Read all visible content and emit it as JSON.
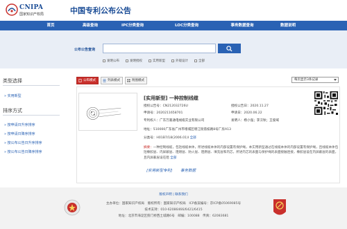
{
  "header": {
    "logo_en": "CNIPA",
    "logo_cn": "国家知识产权局",
    "title": "中国专利公布公告"
  },
  "nav": {
    "items": [
      {
        "label": "首页"
      },
      {
        "label": "高级查询"
      },
      {
        "label": "IPC分类查询"
      },
      {
        "label": "LOC分类查询"
      },
      {
        "label": "事务数据查询"
      },
      {
        "label": "数据说明"
      }
    ]
  },
  "search": {
    "label": "公布公告查询",
    "value": "",
    "placeholder": "",
    "filters": [
      {
        "label": "发明公布"
      },
      {
        "label": "发明授权"
      },
      {
        "label": "实用新型"
      },
      {
        "label": "外观设计"
      },
      {
        "label": "全部"
      }
    ]
  },
  "sidebar": {
    "type_heading": "类型选择",
    "type_items": [
      {
        "label": "实用新型"
      }
    ],
    "sort_heading": "排序方式",
    "sort_items": [
      {
        "label": "按申请日升序排序"
      },
      {
        "label": "按申请日降序排序"
      },
      {
        "label": "按公布公告日升序排序"
      },
      {
        "label": "按公布公告日降序排序"
      }
    ]
  },
  "toolbar": {
    "tabs": [
      {
        "label": "公布模式",
        "active": true
      },
      {
        "label": "列表模式",
        "active": false
      },
      {
        "label": "附图模式",
        "active": false
      }
    ],
    "per_page": "每页显示3条记录"
  },
  "result": {
    "title": "[实用新型] 一种控制线缆",
    "pub_no_label": "授权公告号：",
    "pub_no": "CN212032726U",
    "pub_date_label": "授权公告日：",
    "pub_date": "2020.11.27",
    "app_no_label": "申请号：",
    "app_no": "2020211658701",
    "app_date_label": "申请日：",
    "app_date": "2020.06.22",
    "patentee_label": "专利权人：",
    "patentee": "广东万嘉通电线缆实业有限公司",
    "inventor_label": "发明人：",
    "inventor": "杨小强；李汉秋；王俊域",
    "address_label": "地址：",
    "address": "510000广东省广州市增城区增江街荔枝路8号厂房A13",
    "ipc_label": "分类号：",
    "ipc": "H01B7/18(2006.01)I",
    "ipc_all": "全部",
    "abstract_label": "摘要：",
    "abstract": "一种控制线缆，包括线缆本体，所述线缆本体的内部设置有保护绳，本实用新型通过在线缆本体的内部设置有保护绳，且线缆本体包括橡胶层、内屏蔽层、阻燃层、防火层、阻燃层、填充层和内芯，所述内芯的表面与保护绳的表面接触连接，橡胶层设在内屏蔽层的表面，且内屏蔽层设在阻",
    "abstract_more": "全部",
    "link_doc": "[实用新型专利]",
    "link_tx": "事务数据"
  },
  "footer": {
    "links": "版权声明 | 联系我们",
    "host": "主办单位：国家知识产权局　版权所有：国家知识产权局　ICP备案编号：京ICP备05069085号",
    "support": "技术支持：010-62086466/6421/6415",
    "address": "地址：北京市海淀区蓟门桥西土城路6号　邮编：100088　传真：62083681"
  },
  "colors": {
    "brand_blue": "#2a62b4",
    "accent_red": "#c9302c"
  }
}
